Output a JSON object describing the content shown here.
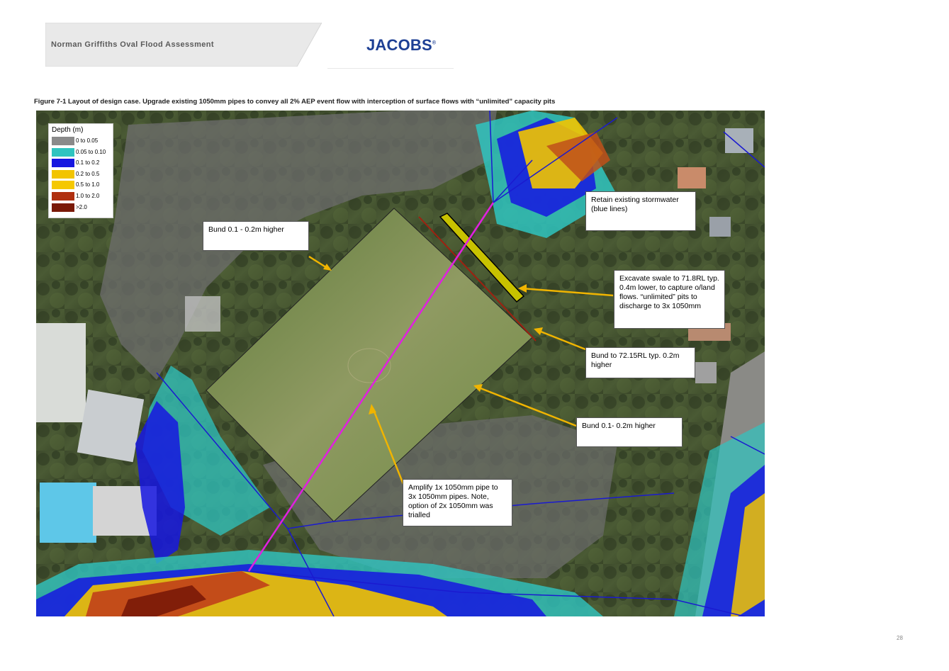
{
  "header": {
    "title": "Norman Griffiths Oval Flood Assessment",
    "logo_text": "JACOBS",
    "logo_mark": "®"
  },
  "figure": {
    "caption": "Figure 7-1 Layout of design case. Upgrade existing 1050mm pipes to convey all 2% AEP event  flow with interception of surface flows with “unlimited” capacity pits"
  },
  "legend": {
    "title": "Depth (m)",
    "items": [
      {
        "label": "0 to 0.05",
        "color": "#8a8a8a"
      },
      {
        "label": "0.05 to 0.10",
        "color": "#2fc4c0"
      },
      {
        "label": "0.1 to 0.2",
        "color": "#1616e0"
      },
      {
        "label": "0.2 to 0.5",
        "color": "#f2c400"
      },
      {
        "label": "0.5 to 1.0",
        "color": "#f5c800"
      },
      {
        "label": "1.0 to 2.0",
        "color": "#b03010"
      },
      {
        "label": ">2.0",
        "color": "#7a1a08"
      }
    ]
  },
  "callouts": {
    "bund_west": "Bund 0.1 - 0.2m higher",
    "retain_stormwater": "Retain existing stormwater (blue lines)",
    "excavate_swale": "Excavate swale to 71.8RL typ. 0.4m lower, to capture o/land flows. “unlimited” pits to discharge to 3x 1050mm",
    "bund_east": "Bund to 72.15RL typ. 0.2m higher",
    "bund_south": "Bund 0.1- 0.2m higher",
    "amplify_pipe": "Amplify 1x 1050mm pipe to 3x 1050mm pipes. Note, option of 2x 1050mm was trialled"
  },
  "colors": {
    "pipe_new": "#e020e0",
    "pipe_existing": "#1a1ad0",
    "arrow": "#f0b400",
    "bund": "#a02010",
    "header_band": "#e9e9e9",
    "logo": "#1d3f94"
  },
  "page_number": "28"
}
